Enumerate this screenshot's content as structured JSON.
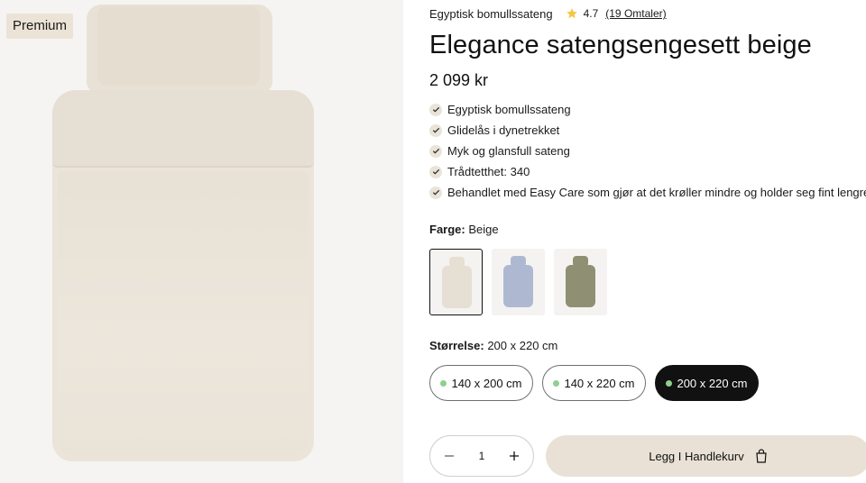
{
  "gallery": {
    "badge": "Premium"
  },
  "product": {
    "subtitle": "Egyptisk bomullssateng",
    "rating": "4.7",
    "reviews_link": "(19 Omtaler)",
    "title": "Elegance satengsengesett beige",
    "price": "2 099 kr",
    "features": [
      "Egyptisk bomullssateng",
      "Glidelås i dynetrekket",
      "Myk og glansfull sateng",
      "Trådtetthet: 340",
      "Behandlet med Easy Care som gjør at det krøller mindre og holder seg fint lengre"
    ]
  },
  "color": {
    "label": "Farge:",
    "value": "Beige",
    "swatches": [
      {
        "color": "#e6dfd3",
        "selected": true
      },
      {
        "color": "#aeb9d1",
        "selected": false
      },
      {
        "color": "#8f8f73",
        "selected": false
      }
    ]
  },
  "size": {
    "label": "Størrelse:",
    "value": "200 x 220 cm",
    "options": [
      {
        "label": "140 x 200 cm",
        "selected": false
      },
      {
        "label": "140 x 220 cm",
        "selected": false
      },
      {
        "label": "200 x 220 cm",
        "selected": true
      }
    ]
  },
  "quantity": {
    "value": "1",
    "minus_icon": "minus-icon",
    "plus_icon": "plus-icon"
  },
  "cart": {
    "label": "Legg I Handlekurv",
    "icon": "shopping-bag-icon"
  },
  "colors": {
    "availability_dot": "#8fcf8f",
    "star": "#f2c744",
    "cart_bg": "#e9e1d6",
    "badge_bg": "#ebe3d6"
  }
}
